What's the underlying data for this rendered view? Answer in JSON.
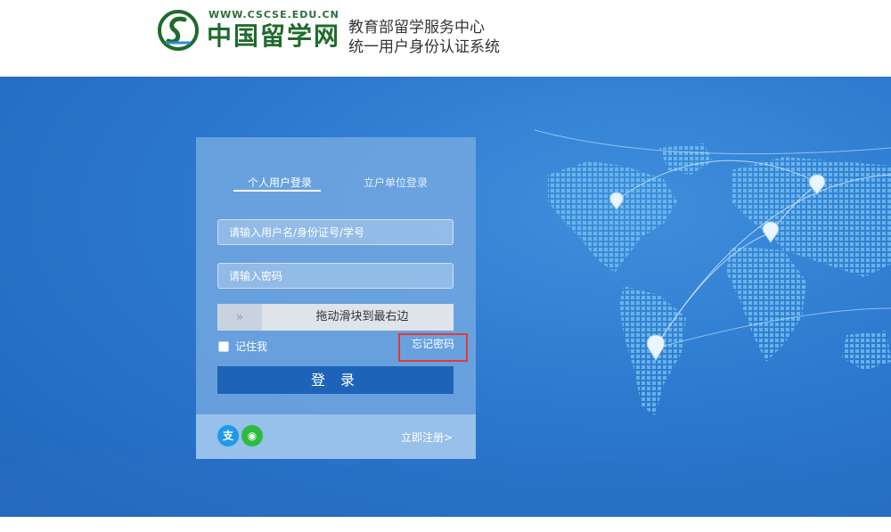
{
  "header": {
    "site_url": "WWW.CSCSE.EDU.CN",
    "brand": "中国留学网",
    "title_line1": "教育部留学服务中心",
    "title_line2": "统一用户身份认证系统"
  },
  "login": {
    "tabs": [
      {
        "label": "个人用户登录",
        "active": true
      },
      {
        "label": "立户单位登录",
        "active": false
      }
    ],
    "username_placeholder": "请输入用户名/身份证号/学号",
    "password_placeholder": "请输入密码",
    "slider_handle": "»",
    "slider_text": "拖动滑块到最右边",
    "remember_label": "记住我",
    "forgot_label": "忘记密码",
    "login_button": "登 录",
    "register_link": "立即注册>",
    "social": [
      {
        "icon": "alipay-icon",
        "glyph": "支"
      },
      {
        "icon": "wechat-icon",
        "glyph": "◉"
      }
    ]
  },
  "colors": {
    "background_blue": "#2c79cf",
    "login_button": "#1d63b8",
    "highlight_border": "#e53935",
    "brand_green": "#1f6b2d"
  }
}
